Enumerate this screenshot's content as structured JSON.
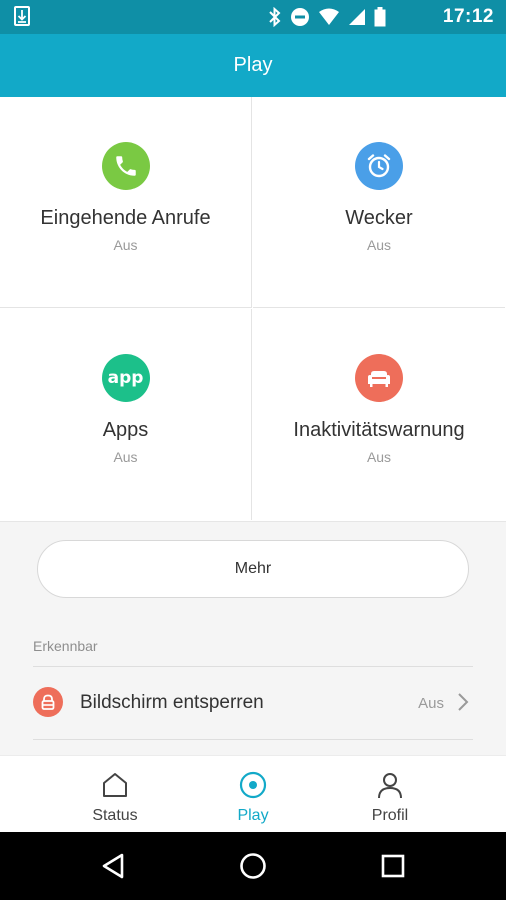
{
  "status_bar": {
    "time": "17:12"
  },
  "app_bar": {
    "title": "Play"
  },
  "tiles": [
    {
      "label": "Eingehende Anrufe",
      "state": "Aus",
      "icon": "phone-icon",
      "color": "#7ac943"
    },
    {
      "label": "Wecker",
      "state": "Aus",
      "icon": "alarm-clock-icon",
      "color": "#4a9fe8"
    },
    {
      "label": "Apps",
      "state": "Aus",
      "icon": "app-icon",
      "icon_text": "app",
      "color": "#1cc08a"
    },
    {
      "label": "Inaktivitätswarnung",
      "state": "Aus",
      "icon": "sofa-icon",
      "color": "#ee6e5a"
    }
  ],
  "more_button": {
    "label": "Mehr"
  },
  "section": {
    "title": "Erkennbar"
  },
  "unlock_row": {
    "label": "Bildschirm entsperren",
    "value": "Aus",
    "icon": "lock-icon",
    "color": "#ee6e5a"
  },
  "bottom_nav": {
    "items": [
      {
        "label": "Status",
        "icon": "home-icon"
      },
      {
        "label": "Play",
        "icon": "play-target-icon",
        "active": true
      },
      {
        "label": "Profil",
        "icon": "person-icon"
      }
    ],
    "active_color": "#12a9c8"
  },
  "colors": {
    "app_bar": "#12a9c8",
    "status_bar": "#0f8fa6"
  }
}
